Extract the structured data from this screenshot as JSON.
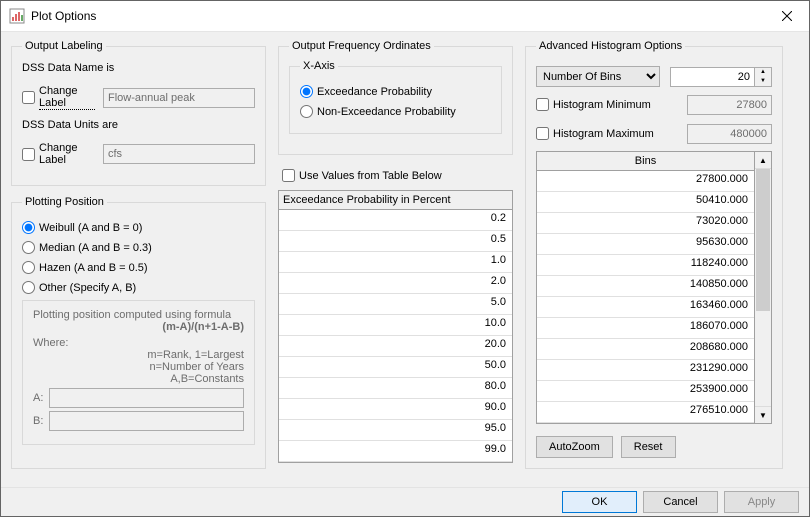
{
  "window": {
    "title": "Plot Options"
  },
  "labeling": {
    "title": "Output Labeling",
    "dss_name_label": "DSS Data Name is",
    "dss_units_label": "DSS Data Units are",
    "change_label": "Change Label",
    "name_value": "Flow-annual peak",
    "units_value": "cfs"
  },
  "plotpos": {
    "title": "Plotting Position",
    "options": [
      "Weibull (A and B = 0)",
      "Median (A and B = 0.3)",
      "Hazen (A and B = 0.5)",
      "Other (Specify A, B)"
    ],
    "formula_label": "Plotting position computed using formula",
    "formula": "(m-A)/(n+1-A-B)",
    "where": "Where:",
    "legend_m": "m=Rank, 1=Largest",
    "legend_n": "n=Number of Years",
    "legend_ab": "A,B=Constants",
    "a_label": "A:",
    "b_label": "B:"
  },
  "freq": {
    "title": "Output Frequency Ordinates",
    "xaxis_title": "X-Axis",
    "xaxis_options": [
      "Exceedance Probability",
      "Non-Exceedance Probability"
    ],
    "use_values_label": "Use Values from Table Below",
    "table_header": "Exceedance Probability in Percent",
    "values": [
      "0.2",
      "0.5",
      "1.0",
      "2.0",
      "5.0",
      "10.0",
      "20.0",
      "50.0",
      "80.0",
      "90.0",
      "95.0",
      "99.0"
    ]
  },
  "hist": {
    "title": "Advanced Histogram Options",
    "select_value": "Number Of Bins",
    "bins_count": "20",
    "min_label": "Histogram Minimum",
    "min_value": "27800",
    "max_label": "Histogram Maximum",
    "max_value": "480000",
    "bins_header": "Bins",
    "bins": [
      "27800.000",
      "50410.000",
      "73020.000",
      "95630.000",
      "118240.000",
      "140850.000",
      "163460.000",
      "186070.000",
      "208680.000",
      "231290.000",
      "253900.000",
      "276510.000"
    ],
    "autozoom": "AutoZoom",
    "reset": "Reset"
  },
  "footer": {
    "ok": "OK",
    "cancel": "Cancel",
    "apply": "Apply"
  }
}
